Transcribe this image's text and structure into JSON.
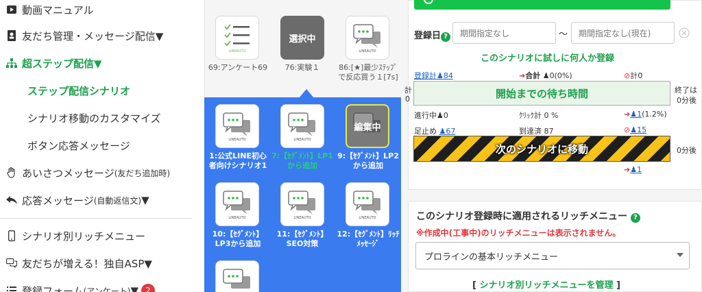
{
  "sidebar": {
    "video_manual": "動画マニュアル",
    "friends_manage": "友だち管理・メッセージ配信▼",
    "super_step": "超ステップ配信▼",
    "step_scenario": "ステップ配信シナリオ",
    "scenario_move": "シナリオ移動のカスタマイズ",
    "button_reply": "ボタン応答メッセージ",
    "greeting_main": "あいさつメッセージ",
    "greeting_sub": "(友だち追加時)",
    "auto_reply_main": "応答メッセージ",
    "auto_reply_sub": "(自動返信文)",
    "auto_reply_arrow": "▼",
    "rich_menu": "シナリオ別リッチメニュー",
    "asp": "友だちが増える！独自ASP▼",
    "form_main": "登録フォーム",
    "form_sub": "(アンケート)",
    "form_arrow": "▼",
    "form_badge": "2"
  },
  "tiles": {
    "lineauto": "LINEAUTO",
    "selected_label": "選択中",
    "editing_label": "編集中",
    "top": [
      {
        "caption": "69:アンケート69"
      },
      {
        "caption": "76:実験１"
      },
      {
        "caption": "86:[★]最少ｽﾃｯﾌﾟで反応買う１[7s]"
      }
    ],
    "grid": [
      {
        "caption": "1:公式LINE初心者向けシナリオ1"
      },
      {
        "caption": "7:【ｾｸﾞﾒﾝﾄ】LP1から追加"
      },
      {
        "caption": "9:【ｾｸﾞﾒﾝﾄ】LP2から追加"
      },
      {
        "caption": "10:【ｾｸﾞﾒﾝﾄ】LP3から追加"
      },
      {
        "caption": "11:【ｾｸﾞﾒﾝﾄ】SEO対策"
      },
      {
        "caption": "12:【ｾｸﾞﾒﾝﾄ】ﾘｯﾁﾒｯｾｰｼﾞ"
      }
    ]
  },
  "panel": {
    "reg_date_label": "登録日",
    "date_from_placeholder": "期間指定なし",
    "date_to_placeholder": "期間指定なし(現在)",
    "tilde": "〜",
    "trial_register": "このシナリオに試しに何人か登録",
    "reg_total_label": "登録計",
    "reg_total_val": "84",
    "sum_label": "合計",
    "sum_val": "0(0%)",
    "block_label": "計",
    "block_val": "0",
    "left_total": "計",
    "left_zero": "0",
    "wait_bar": "開始までの待ち時間",
    "end_label": "終了は",
    "end_after": "0分後",
    "in_progress_label": "進行中",
    "in_progress_val": "0",
    "click_total": "ｸﾘｯｸ計 0 %",
    "exit_val": "1",
    "exit_pct": "(1.2%)",
    "stopped_label": "足止め",
    "stopped_val": "67",
    "reached_label": "到達済 87",
    "block_val2": "15",
    "move_bar": "次のシナリオに移動",
    "move_after": "0分後",
    "exit_val2": "1",
    "rich_title": "このシナリオ登録時に適用されるリッチメニュー",
    "rich_warning": "※作成中(工事中)のリッチメニューは表示されません。",
    "rich_select": "プロラインの基本リッチメニュー",
    "manage_link_open": "[",
    "manage_link": "シナリオ別リッチメニューを管理",
    "manage_link_close": "]",
    "help_q": "?"
  },
  "colors": {
    "accent_green": "#1ba24c",
    "blue_panel": "#3a7bf0",
    "red": "#e0383e"
  }
}
